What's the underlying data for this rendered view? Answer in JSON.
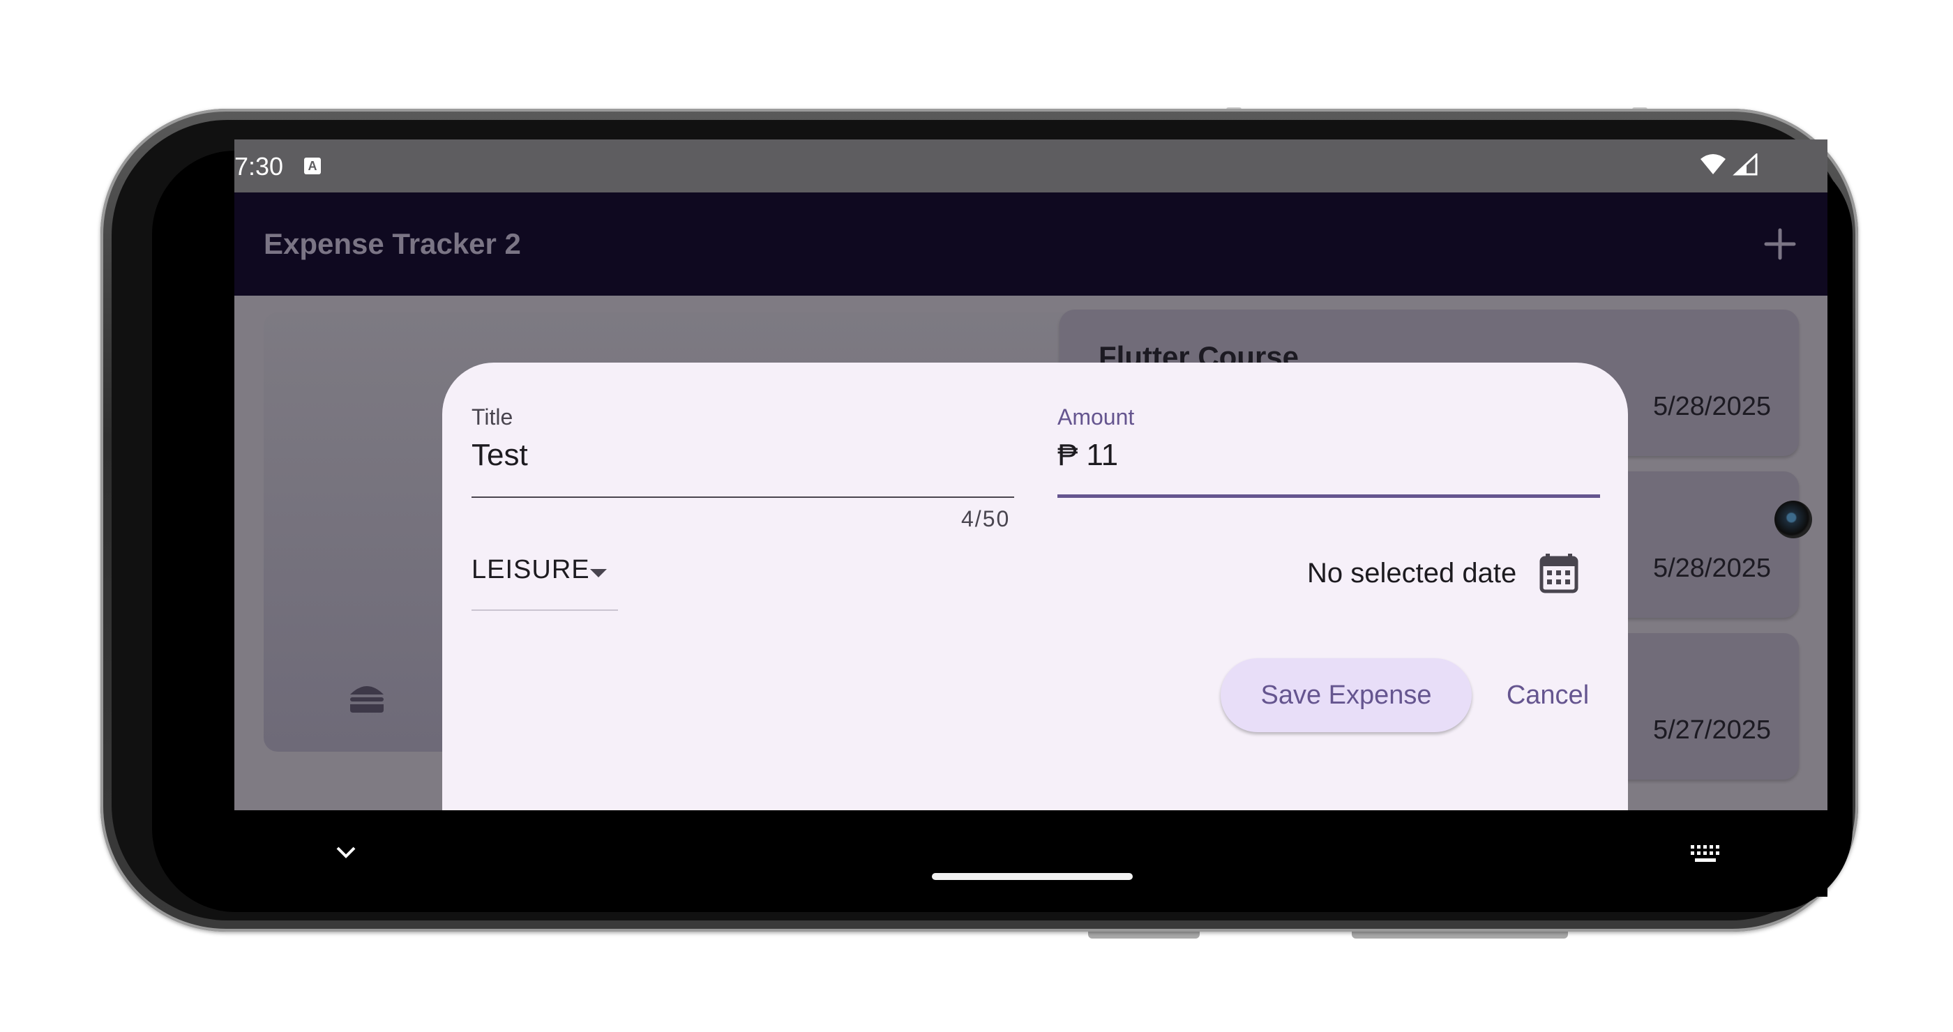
{
  "status_bar": {
    "time": "7:30",
    "notification_glyph": "A",
    "icons": [
      "wifi-icon",
      "cell-signal-icon"
    ]
  },
  "app_bar": {
    "title": "Expense Tracker 2",
    "action_icon": "add-icon"
  },
  "background": {
    "category_icon": "burger-icon",
    "expenses": [
      {
        "title": "Flutter Course",
        "date": "5/28/2025"
      },
      {
        "title": "",
        "date": "5/28/2025"
      },
      {
        "title": "",
        "date": "5/27/2025"
      }
    ]
  },
  "dialog": {
    "title_field": {
      "label": "Title",
      "value": "Test",
      "counter": "4/50"
    },
    "amount_field": {
      "label": "Amount",
      "prefix": "₱",
      "value": "11"
    },
    "category": {
      "selected": "LEISURE"
    },
    "date": {
      "text": "No selected date",
      "icon": "calendar-icon"
    },
    "save_label": "Save Expense",
    "cancel_label": "Cancel"
  },
  "colors": {
    "primary": "#65558f",
    "sheet_background": "#f6f0f9",
    "tonal_button": "#e8def8",
    "app_bar": "#0f0920"
  }
}
